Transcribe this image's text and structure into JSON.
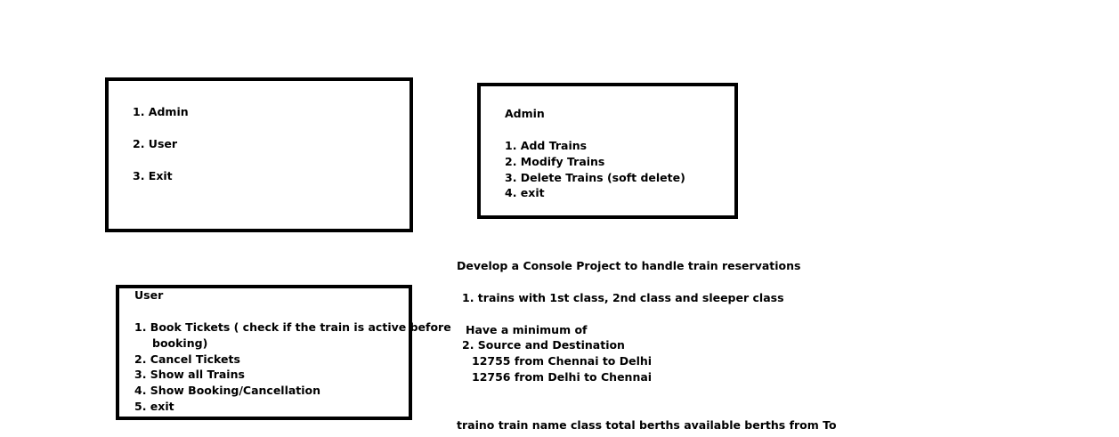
{
  "main_menu": {
    "items": [
      "1. Admin",
      "2. User",
      "3. Exit"
    ]
  },
  "admin_menu": {
    "title": "Admin",
    "items": [
      "1. Add Trains",
      "2. Modify Trains",
      "3. Delete Trains  (soft delete)",
      "4. exit"
    ]
  },
  "user_menu": {
    "title": "User",
    "item1_line1": "1. Book Tickets  ( check if the train is active before",
    "item1_line2": "booking)",
    "items": [
      "2. Cancel Tickets",
      "3. Show all Trains",
      "4. Show Booking/Cancellation",
      "5. exit"
    ]
  },
  "notes": {
    "heading": "Develop a Console Project to handle train reservations",
    "point1": "1.  trains with 1st class, 2nd class and sleeper class",
    "minimum": "Have a minimum of",
    "point2": "2. Source and Destination",
    "route1": "12755   from  Chennai to Delhi",
    "route2": "12756   from Delhi to Chennai",
    "table_header": "traino   train name   class  total berths available berths  from     To"
  }
}
